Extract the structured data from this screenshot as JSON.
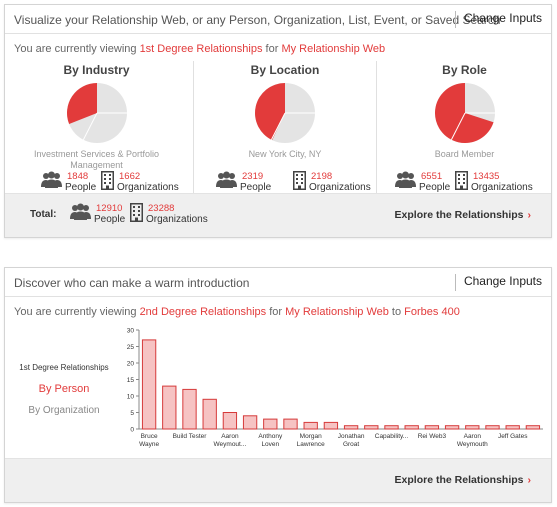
{
  "card1": {
    "title": "Visualize your Relationship Web, or any Person, Organization, List, Event, or Saved Search",
    "change_inputs": "Change Inputs",
    "viewing_prefix": "You are currently viewing",
    "viewing_degree": "1st Degree Relationships",
    "viewing_for": "for",
    "viewing_web": "My Relationship Web",
    "columns": [
      {
        "title": "By Industry",
        "pie_label": "Investment Services & Portfolio Management",
        "highlight_fraction": 0.31,
        "people": "1848",
        "orgs": "1662",
        "people_label": "People",
        "orgs_label": "Organizations"
      },
      {
        "title": "By Location",
        "pie_label": "New York City, NY",
        "highlight_fraction": 0.43,
        "people": "2319",
        "orgs": "2198",
        "people_label": "People",
        "orgs_label": "Organizations"
      },
      {
        "title": "By Role",
        "pie_label": "Board Member",
        "highlight_fraction": 0.7,
        "people": "6551",
        "orgs": "13435",
        "people_label": "People",
        "orgs_label": "Organizations"
      }
    ],
    "footer": {
      "total_label": "Total:",
      "people": "12910",
      "people_label": "People",
      "orgs": "23288",
      "orgs_label": "Organizations",
      "explore": "Explore the Relationships",
      "arrow": "›"
    }
  },
  "card2": {
    "title": "Discover who can make a warm introduction",
    "change_inputs": "Change Inputs",
    "viewing_prefix": "You are currently viewing",
    "viewing_degree": "2nd Degree Relationships",
    "viewing_for": "for",
    "viewing_web": "My Relationship Web",
    "viewing_to": "to",
    "viewing_list": "Forbes 400",
    "side_heading": "1st Degree Relationships",
    "side_by_person": "By Person",
    "side_by_org": "By Organization",
    "footer": {
      "explore": "Explore the Relationships",
      "arrow": "›"
    }
  },
  "colors": {
    "accent": "#e23b3b",
    "pie_gray": "#e4e4e4",
    "bar_fill": "#f6c3c3",
    "bar_stroke": "#d63a3a",
    "footer_bg": "#efefef"
  },
  "icons": [
    "people-icon",
    "building-icon",
    "chevron-right-icon"
  ],
  "chart_data": {
    "type": "bar",
    "categories": [
      "Bruce Wayne",
      "",
      "Build Tester",
      "",
      "Aaron Weymout...",
      "",
      "Anthony Loven",
      "",
      "Morgan Lawrence",
      "",
      "Jonathan Groat",
      "",
      "Capability...",
      "",
      "Rei Web3",
      "",
      "Aaron Weymouth",
      "",
      "Jeff Gates",
      ""
    ],
    "tick_labels": [
      [
        "Bruce",
        "Wayne"
      ],
      [],
      [
        "Build Tester"
      ],
      [],
      [
        "Aaron",
        "Weymout..."
      ],
      [],
      [
        "Anthony",
        "Loven"
      ],
      [],
      [
        "Morgan",
        "Lawrence"
      ],
      [],
      [
        "Jonathan",
        "Groat"
      ],
      [],
      [
        "Capability..."
      ],
      [],
      [
        "Rei Web3"
      ],
      [],
      [
        "Aaron",
        "Weymouth"
      ],
      [],
      [
        "Jeff Gates"
      ],
      []
    ],
    "values": [
      27,
      13,
      12,
      9,
      5,
      4,
      3,
      3,
      2,
      2,
      1,
      1,
      1,
      1,
      1,
      1,
      1,
      1,
      1,
      1
    ],
    "ylim": [
      0,
      30
    ],
    "yticks": [
      0,
      5,
      10,
      15,
      20,
      25,
      30
    ],
    "grid": false,
    "title": "",
    "xlabel": "",
    "ylabel": ""
  }
}
